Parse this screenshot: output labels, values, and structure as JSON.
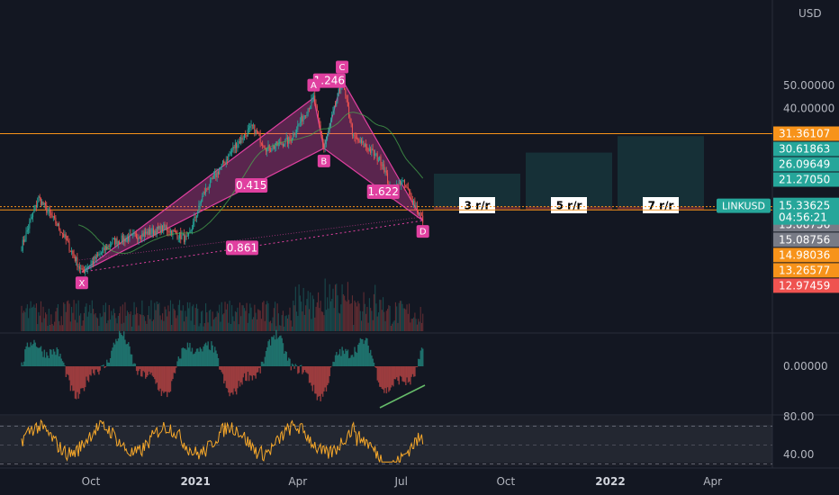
{
  "chart_data": {
    "type": "candlestick",
    "symbol": "LINKUSD",
    "currency": "USD",
    "last_price": "15.33625",
    "countdown": "04:56:21",
    "log_scale": true,
    "price_axis": {
      "ticks": [
        {
          "label": "50.00000",
          "value": 50
        },
        {
          "label": "40.00000",
          "value": 40
        }
      ]
    },
    "time_axis": [
      "Oct",
      "2021",
      "Apr",
      "Jul",
      "Oct",
      "2022",
      "Apr"
    ],
    "price_labels": [
      {
        "text": "31.36107",
        "value": 31.36,
        "color": "#f7931a"
      },
      {
        "text": "30.61863",
        "value": 30.62,
        "color": "#26a69a"
      },
      {
        "text": "26.09649",
        "value": 26.1,
        "color": "#26a69a"
      },
      {
        "text": "21.27050",
        "value": 21.27,
        "color": "#26a69a"
      },
      {
        "text": "15.08757",
        "value": 15.09,
        "color": "#787b86"
      },
      {
        "text": "15.08756",
        "value": 15.09,
        "color": "#787b86"
      },
      {
        "text": "15.08756",
        "value": 15.09,
        "color": "#787b86"
      },
      {
        "text": "14.98036",
        "value": 14.98,
        "color": "#f7931a"
      },
      {
        "text": "13.26577",
        "value": 13.27,
        "color": "#f7931a"
      },
      {
        "text": "12.97459",
        "value": 12.97,
        "color": "#ef5350"
      }
    ],
    "pattern": {
      "points": [
        {
          "name": "X",
          "date": "2020-09-23",
          "price": 8.2
        },
        {
          "name": "A",
          "date": "2021-04-15",
          "price": 44.4
        },
        {
          "name": "B",
          "date": "2021-04-24",
          "price": 27.2
        },
        {
          "name": "C",
          "date": "2021-05-10",
          "price": 52.9
        },
        {
          "name": "D",
          "date": "2021-07-20",
          "price": 13.5
        }
      ],
      "ratios": [
        {
          "label": "0.415"
        },
        {
          "label": "0.861"
        },
        {
          "label": "1.246"
        },
        {
          "label": "1.622"
        }
      ]
    },
    "targets": [
      {
        "label": "3 r/r",
        "price": 21.27
      },
      {
        "label": "5 r/r",
        "price": 26.1
      },
      {
        "label": "7 r/r",
        "price": 30.62
      }
    ],
    "moving_average_color": "#4caf50",
    "macd_axis": {
      "label": "0.00000",
      "value": 0
    },
    "rsi_axis": {
      "ticks": [
        {
          "label": "80.00",
          "value": 80
        },
        {
          "label": "40.00",
          "value": 40
        }
      ]
    },
    "colors": {
      "up": "#26a69a",
      "down": "#ef5350",
      "pattern": "#e040a0",
      "level": "#f7931a",
      "rsi": "#f7a82a"
    }
  }
}
